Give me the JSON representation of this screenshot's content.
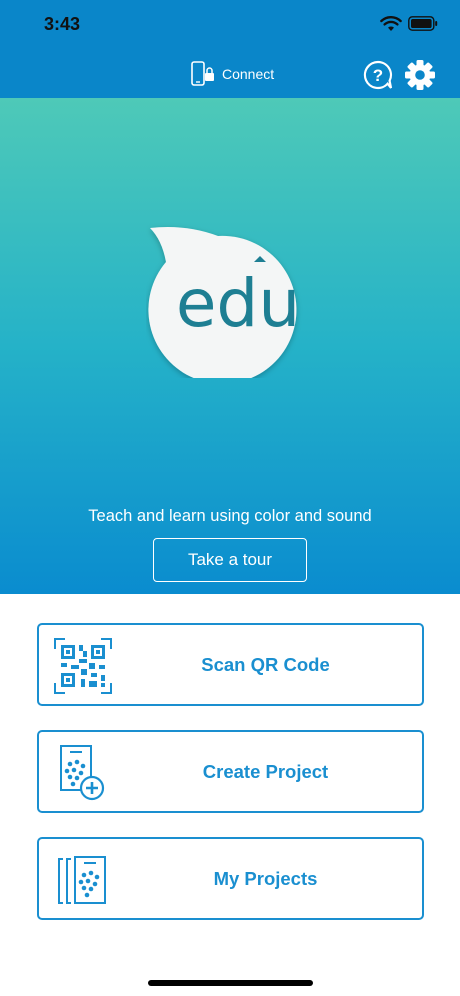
{
  "status": {
    "time": "3:43"
  },
  "nav": {
    "connect_label": "Connect"
  },
  "hero": {
    "logo_text": "edu",
    "tagline": "Teach and learn using color and sound",
    "tour_label": "Take a tour"
  },
  "actions": [
    {
      "label": "Scan QR Code",
      "icon": "qr-code-icon"
    },
    {
      "label": "Create Project",
      "icon": "create-project-icon"
    },
    {
      "label": "My Projects",
      "icon": "my-projects-icon"
    }
  ],
  "colors": {
    "accent": "#1a8fd0",
    "header": "#0a86c9",
    "gradient_top": "#4ec9b8",
    "gradient_bottom": "#0a8ccf",
    "logo_text": "#1e7f93"
  }
}
